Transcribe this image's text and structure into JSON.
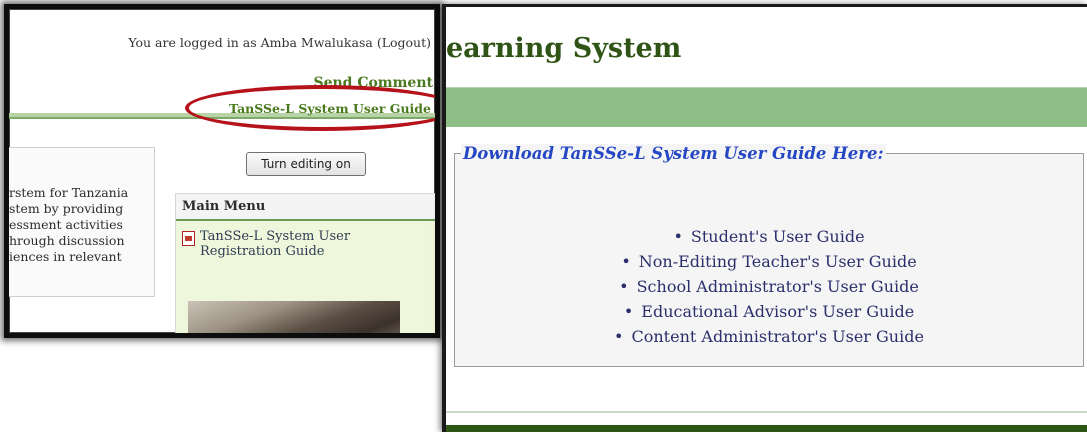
{
  "left_panel": {
    "login_text": "You are logged in as Amba Mwalukasa",
    "logout_label": "(Logout)",
    "send_comment": "Send Comment",
    "user_guide_link": "TanSSe-L System User Guide",
    "turn_editing_button": "Turn editing on",
    "intro_lines": [
      "rstem for Tanzania",
      "stem by providing",
      "essment activities",
      "hrough discussion",
      "iences in relevant"
    ],
    "main_menu": {
      "title": "Main Menu",
      "items": [
        {
          "label": "TanSSe-L System User Registration Guide",
          "icon": "pdf-icon"
        }
      ]
    },
    "highlight_color": "#b5121b"
  },
  "right_panel": {
    "site_title_fragment": "earning System",
    "download_heading": "Download TanSSe-L System User Guide Here:",
    "guides": [
      "Student's User Guide",
      "Non-Editing Teacher's User Guide",
      "School Administrator's User Guide",
      "Educational Advisor's User Guide",
      "Content Administrator's User Guide"
    ],
    "colors": {
      "title": "#2f5416",
      "band": "#8fbf86",
      "heading": "#2647c4",
      "bottom_band": "#2c5516"
    }
  }
}
